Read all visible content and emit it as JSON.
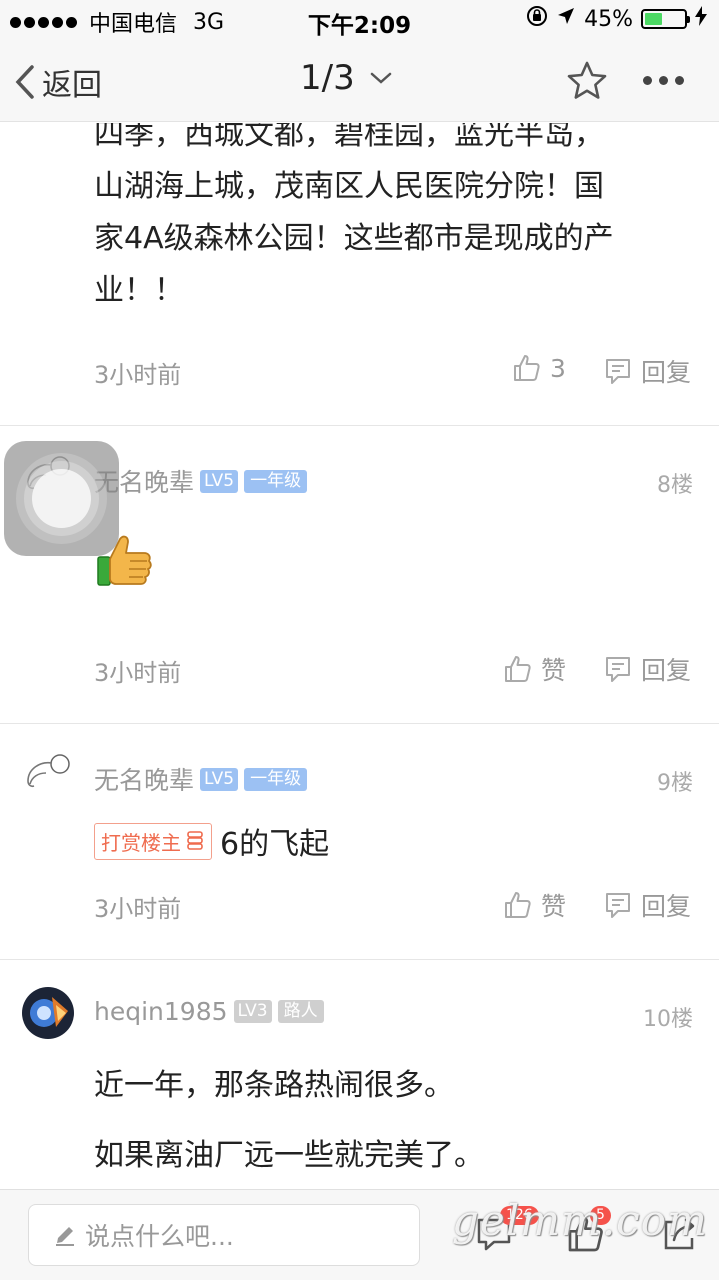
{
  "status_bar": {
    "carrier": "中国电信",
    "network": "3G",
    "time": "下午2:09",
    "battery": "45%",
    "battery_level": 0.45
  },
  "nav": {
    "back_label": "返回",
    "page_indicator": "1/3"
  },
  "post_partial": {
    "lines": [
      "四季，西城文都，碧桂园，蓝光半岛，",
      "山湖海上城，茂南区人民医院分院！国",
      "家4A级森林公园！这些都市是现成的产",
      "业！！"
    ],
    "time": "3小时前",
    "like_count": "3",
    "reply_label": "回复"
  },
  "comments": [
    {
      "username": "无名晚辈",
      "level": "LV5",
      "grade": "一年级",
      "floor": "8楼",
      "time": "3小时前",
      "like_label": "赞",
      "reply_label": "回复"
    },
    {
      "username": "无名晚辈",
      "level": "LV5",
      "grade": "一年级",
      "floor": "9楼",
      "reward_tag": "打赏楼主",
      "text": "6的飞起",
      "time": "3小时前",
      "like_label": "赞",
      "reply_label": "回复"
    },
    {
      "username": "heqin1985",
      "level": "LV3",
      "grade": "路人",
      "floor": "10楼",
      "lines": [
        "近一年，那条路热闹很多。",
        "如果离油厂远一些就完美了。"
      ]
    }
  ],
  "bottom_bar": {
    "input_placeholder": "说点什么吧...",
    "comment_badge": "126",
    "like_badge": "5",
    "watermark": "gelmm.com"
  },
  "colors": {
    "level_badge": "#9cc1f3",
    "reward_border": "#f3a08c",
    "badge_red": "#f5524b",
    "battery_green": "#4cd964"
  }
}
